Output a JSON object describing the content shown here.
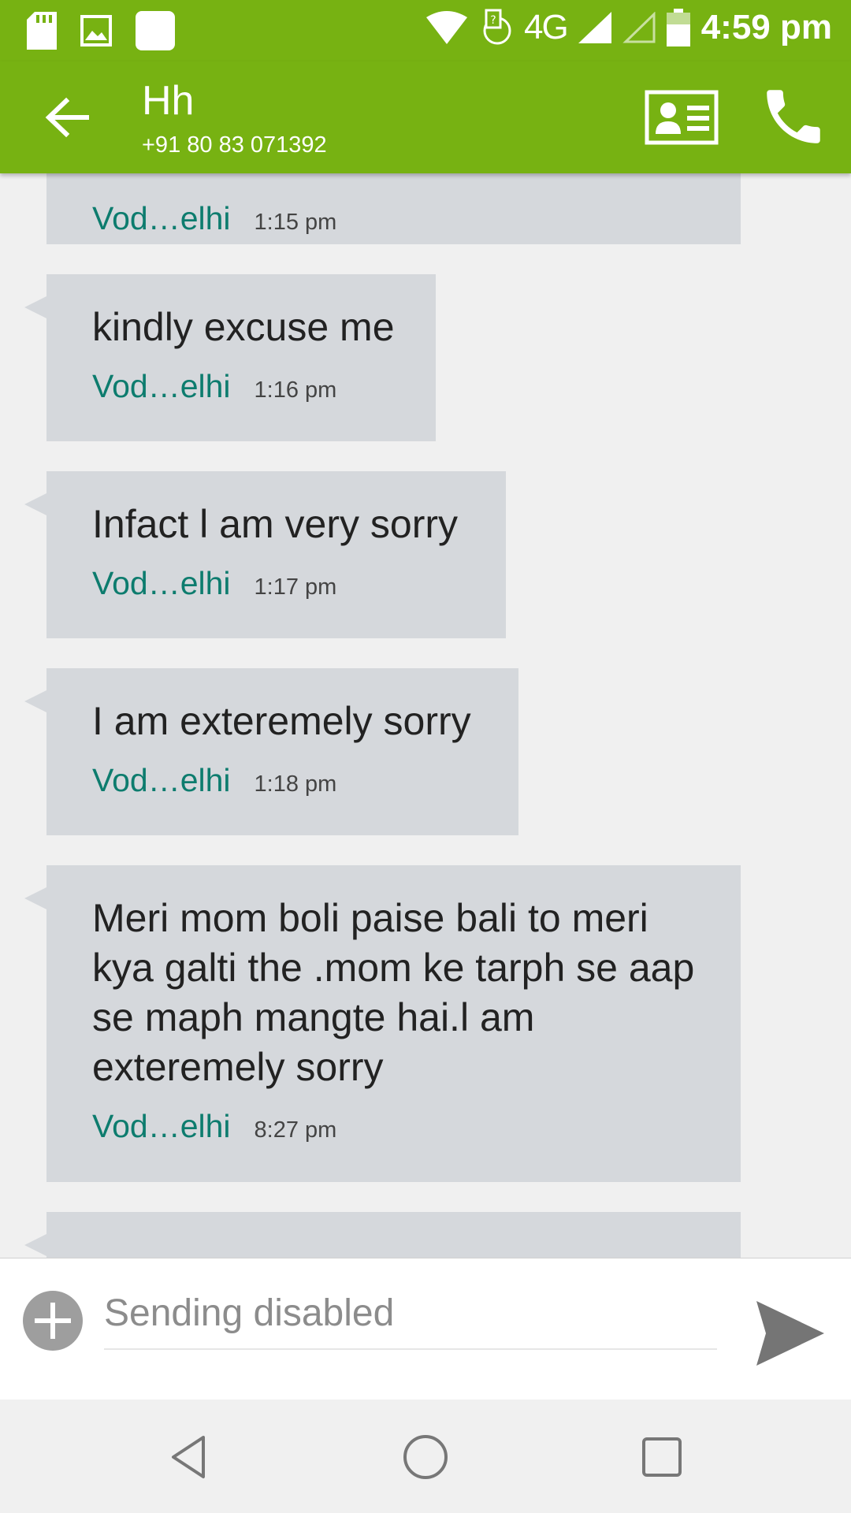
{
  "status_bar": {
    "network": "4G",
    "time": "4:59 pm",
    "icons": [
      "sd-card-icon",
      "image-icon",
      "app-notification-icon",
      "wifi-icon",
      "data-transfer-icon",
      "signal-icon",
      "signal-empty-icon",
      "battery-icon"
    ]
  },
  "header": {
    "contact_name": "Hh",
    "contact_number": "+91 80 83 071392",
    "icons": [
      "back-arrow-icon",
      "contact-card-icon",
      "phone-icon"
    ]
  },
  "messages": [
    {
      "text": "",
      "sim": "Vod…elhi",
      "time": "1:15 pm"
    },
    {
      "text": "kindly excuse me",
      "sim": "Vod…elhi",
      "time": "1:16 pm"
    },
    {
      "text": "Infact l am very sorry",
      "sim": "Vod…elhi",
      "time": "1:17 pm"
    },
    {
      "text": "I am exteremely sorry",
      "sim": "Vod…elhi",
      "time": "1:18 pm"
    },
    {
      "text": "Meri mom boli paise bali to meri kya galti the .mom ke tarph se aap se maph mangte hai.l am exteremely sorry",
      "sim": "Vod…elhi",
      "time": "8:27 pm"
    }
  ],
  "compose": {
    "placeholder": "Sending disabled",
    "icons": [
      "add-attachment-icon",
      "send-icon"
    ]
  },
  "nav": {
    "icons": [
      "back-nav-icon",
      "home-nav-icon",
      "recents-nav-icon"
    ]
  },
  "colors": {
    "accent": "#77b212",
    "bubble": "#d5d8dc",
    "sim_label": "#0d7c6e"
  }
}
